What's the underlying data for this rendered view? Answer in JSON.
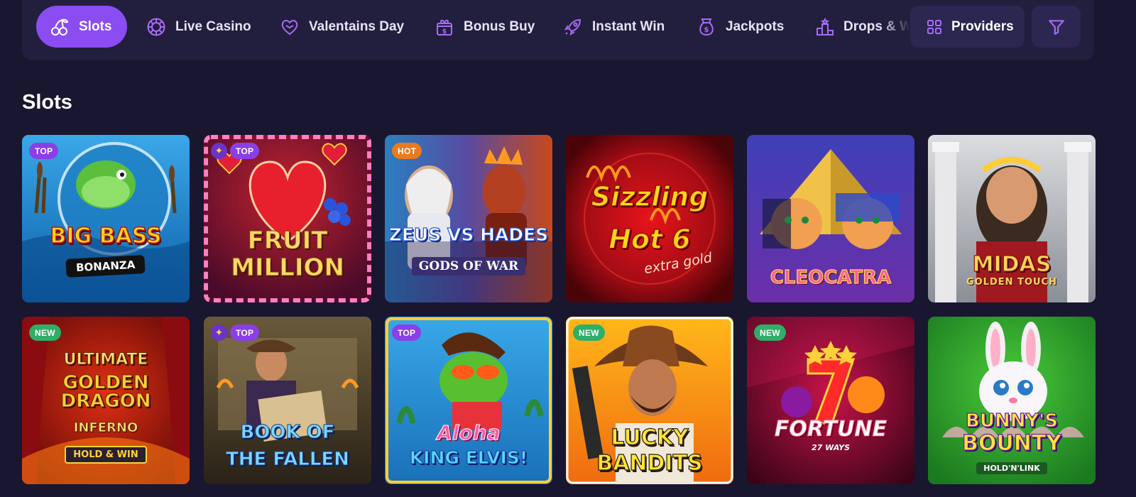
{
  "nav": {
    "categories": [
      {
        "label": "Slots",
        "icon": "cherries-icon",
        "active": true
      },
      {
        "label": "Live Casino",
        "icon": "roulette-icon"
      },
      {
        "label": "Valentains Day",
        "icon": "hearts-icon"
      },
      {
        "label": "Bonus Buy",
        "icon": "gift-dollar-icon"
      },
      {
        "label": "Instant Win",
        "icon": "rocket-icon"
      },
      {
        "label": "Jackpots",
        "icon": "money-bag-icon"
      },
      {
        "label": "Drops & Wins",
        "icon": "podium-icon"
      }
    ],
    "providers_label": "Providers",
    "filter_icon": "filter-icon"
  },
  "section": {
    "title": "Slots"
  },
  "games": [
    {
      "title_line1": "Big Bass",
      "title_line2": "Bonanza",
      "badges": [
        "TOP"
      ]
    },
    {
      "title_line1": "Fruit",
      "title_line2": "Million",
      "badges": [
        "star",
        "TOP"
      ]
    },
    {
      "title_line1": "Zeus vs Hades",
      "title_line2": "Gods of War",
      "badges": [
        "HOT"
      ]
    },
    {
      "title_line1": "Sizzling",
      "title_line2": "Hot 6",
      "subtitle": "extra gold",
      "badges": []
    },
    {
      "title_line1": "Cleocatra",
      "badges": []
    },
    {
      "title_line1": "Midas",
      "title_line2": "Golden Touch",
      "badges": []
    },
    {
      "title_line1": "Ultimate",
      "title_line2": "Golden Dragon",
      "title_line3": "Inferno",
      "subtitle": "Hold & Win",
      "badges": [
        "NEW"
      ]
    },
    {
      "title_line1": "Book of",
      "title_line2": "The Fallen",
      "badges": [
        "star",
        "TOP"
      ]
    },
    {
      "title_line1": "Aloha",
      "title_line2": "King Elvis!",
      "badges": [
        "TOP"
      ]
    },
    {
      "title_line1": "Lucky",
      "title_line2": "Bandits",
      "badges": [
        "NEW"
      ]
    },
    {
      "title_line1": "Fortune",
      "subtitle": "27 Ways",
      "badges": [
        "NEW"
      ]
    },
    {
      "title_line1": "Bunny's",
      "title_line2": "Bounty",
      "subtitle": "Hold'n'Link",
      "badges": []
    }
  ],
  "colors": {
    "accent": "#8b4cf2",
    "background": "#191630",
    "bar": "#221e3e",
    "badge_top": "#8b3fe6",
    "badge_hot": "#e87a1f",
    "badge_new": "#2fae68"
  }
}
